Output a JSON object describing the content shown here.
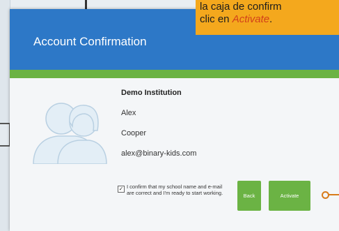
{
  "dialog": {
    "title": "Account Confirmation"
  },
  "account": {
    "institution": "Demo Institution",
    "first_name": "Alex",
    "last_name": "Cooper",
    "email": "alex@binary-kids.com"
  },
  "confirm": {
    "checked": true,
    "check_glyph": "✓",
    "text": "I confirm that my school name and e-mail are correct and I'm ready to start working."
  },
  "buttons": {
    "back_label": "Back",
    "activate_label": "Activate"
  },
  "callout": {
    "line1": "la caja de confirm",
    "line2_prefix": "clic en ",
    "line2_emph": "Activate",
    "line2_suffix": "."
  },
  "colors": {
    "header_blue": "#2d78c7",
    "accent_green": "#6bb344",
    "callout_orange": "#f4a81d",
    "emphasis_red": "#d2401a"
  },
  "icons": {
    "avatar": "user-pair-icon"
  }
}
